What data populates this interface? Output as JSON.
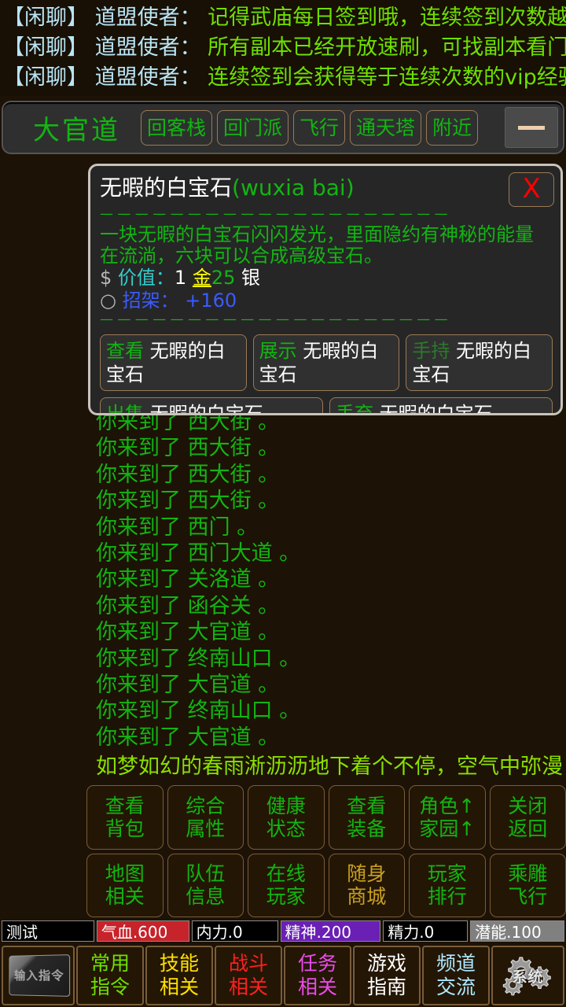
{
  "chat": {
    "lines": [
      {
        "channel": "【闲聊】",
        "speaker": " 道盟使者：",
        "message": " 记得武庙每日签到哦，连续签到次数越多，奖"
      },
      {
        "channel": "【闲聊】",
        "speaker": " 道盟使者：",
        "message": " 所有副本已经开放速刷，可找副本看门人问询"
      },
      {
        "channel": "【闲聊】",
        "speaker": " 道盟使者：",
        "message": " 连续签到会获得等于连续次数的vip经验。"
      }
    ]
  },
  "navbar": {
    "location": "大官道",
    "buttons": [
      "回客栈",
      "回门派",
      "飞行",
      "通天塔",
      "附近"
    ],
    "minimize_icon": "minimize-icon"
  },
  "dialog": {
    "title_cn": "无暇的白宝石",
    "title_pinyin": "(wuxia bai)",
    "close_label": "X",
    "rule": "— — — — — — — — — — — — — — — — — — — —",
    "description": "一块无暇的白宝石闪闪发光，里面隐约有神秘的能量在流淌，六块可以合成高级宝石。",
    "value_icon": "$",
    "value_label": "价值：",
    "value_gold": "1",
    "value_gold_unit": "金",
    "value_silver": "25",
    "value_silver_unit": "银",
    "stat_icon": "○",
    "stat_label": "招架：",
    "stat_value": "+160",
    "actions": [
      {
        "verb": "查看",
        "object": " 无暇的白宝石",
        "muted": false
      },
      {
        "verb": "展示",
        "object": " 无暇的白宝石",
        "muted": false
      },
      {
        "verb": "手持",
        "object": " 无暇的白宝石",
        "muted": true
      },
      {
        "verb": "出售",
        "object": " 无暇的白宝石",
        "muted": false
      },
      {
        "verb": "丢弃",
        "object": " 无暇的白宝石",
        "muted": false
      }
    ]
  },
  "log": {
    "lines": [
      {
        "text": "你来到了 西大街 。",
        "kind": "move"
      },
      {
        "text": "你来到了 西大街 。",
        "kind": "move"
      },
      {
        "text": "你来到了 西大街 。",
        "kind": "move"
      },
      {
        "text": "你来到了 西大街 。",
        "kind": "move"
      },
      {
        "text": "你来到了 西门 。",
        "kind": "move"
      },
      {
        "text": "你来到了 西门大道 。",
        "kind": "move"
      },
      {
        "text": "你来到了 关洛道 。",
        "kind": "move"
      },
      {
        "text": "你来到了 函谷关 。",
        "kind": "move"
      },
      {
        "text": "你来到了 大官道 。",
        "kind": "move"
      },
      {
        "text": "你来到了 终南山口 。",
        "kind": "move"
      },
      {
        "text": "你来到了 大官道 。",
        "kind": "move"
      },
      {
        "text": "你来到了 终南山口 。",
        "kind": "move"
      },
      {
        "text": "你来到了 大官道 。",
        "kind": "move"
      },
      {
        "text": "如梦如幻的春雨淅沥沥地下着个不停，空气中弥漫着泥土的芳香。桃花开了。",
        "kind": "weather"
      }
    ]
  },
  "commands": [
    {
      "l1": "查看",
      "l2": "背包",
      "tone": "green"
    },
    {
      "l1": "综合",
      "l2": "属性",
      "tone": "green"
    },
    {
      "l1": "健康",
      "l2": "状态",
      "tone": "green"
    },
    {
      "l1": "查看",
      "l2": "装备",
      "tone": "green"
    },
    {
      "l1": "角色↑",
      "l2": "家园↑",
      "tone": "green"
    },
    {
      "l1": "关闭",
      "l2": "返回",
      "tone": "green"
    },
    {
      "l1": "地图",
      "l2": "相关",
      "tone": "green"
    },
    {
      "l1": "队伍",
      "l2": "信息",
      "tone": "green"
    },
    {
      "l1": "在线",
      "l2": "玩家",
      "tone": "green"
    },
    {
      "l1": "随身",
      "l2": "商城",
      "tone": "gold"
    },
    {
      "l1": "玩家",
      "l2": "排行",
      "tone": "green"
    },
    {
      "l1": "乘雕",
      "l2": "飞行",
      "tone": "green"
    }
  ],
  "status": {
    "player_name": "测试",
    "hp": "气血.600",
    "mp": "内力.0",
    "spirit": "精神.200",
    "energy": "精力.0",
    "potential": "潜能.100",
    "colors": {
      "hp": "#c7232b",
      "spirit": "#6a1fb5",
      "potential": "#808080"
    }
  },
  "toolbar": {
    "input_command_label": "输入指令",
    "items": [
      {
        "l1": "常用",
        "l2": "指令",
        "tone": "c-green"
      },
      {
        "l1": "技能",
        "l2": "相关",
        "tone": "c-yellow"
      },
      {
        "l1": "战斗",
        "l2": "相关",
        "tone": "c-red"
      },
      {
        "l1": "任务",
        "l2": "相关",
        "tone": "c-pink"
      },
      {
        "l1": "游戏",
        "l2": "指南",
        "tone": "c-white"
      },
      {
        "l1": "频道",
        "l2": "交流",
        "tone": "c-cyan"
      }
    ],
    "system_label": "系统"
  }
}
